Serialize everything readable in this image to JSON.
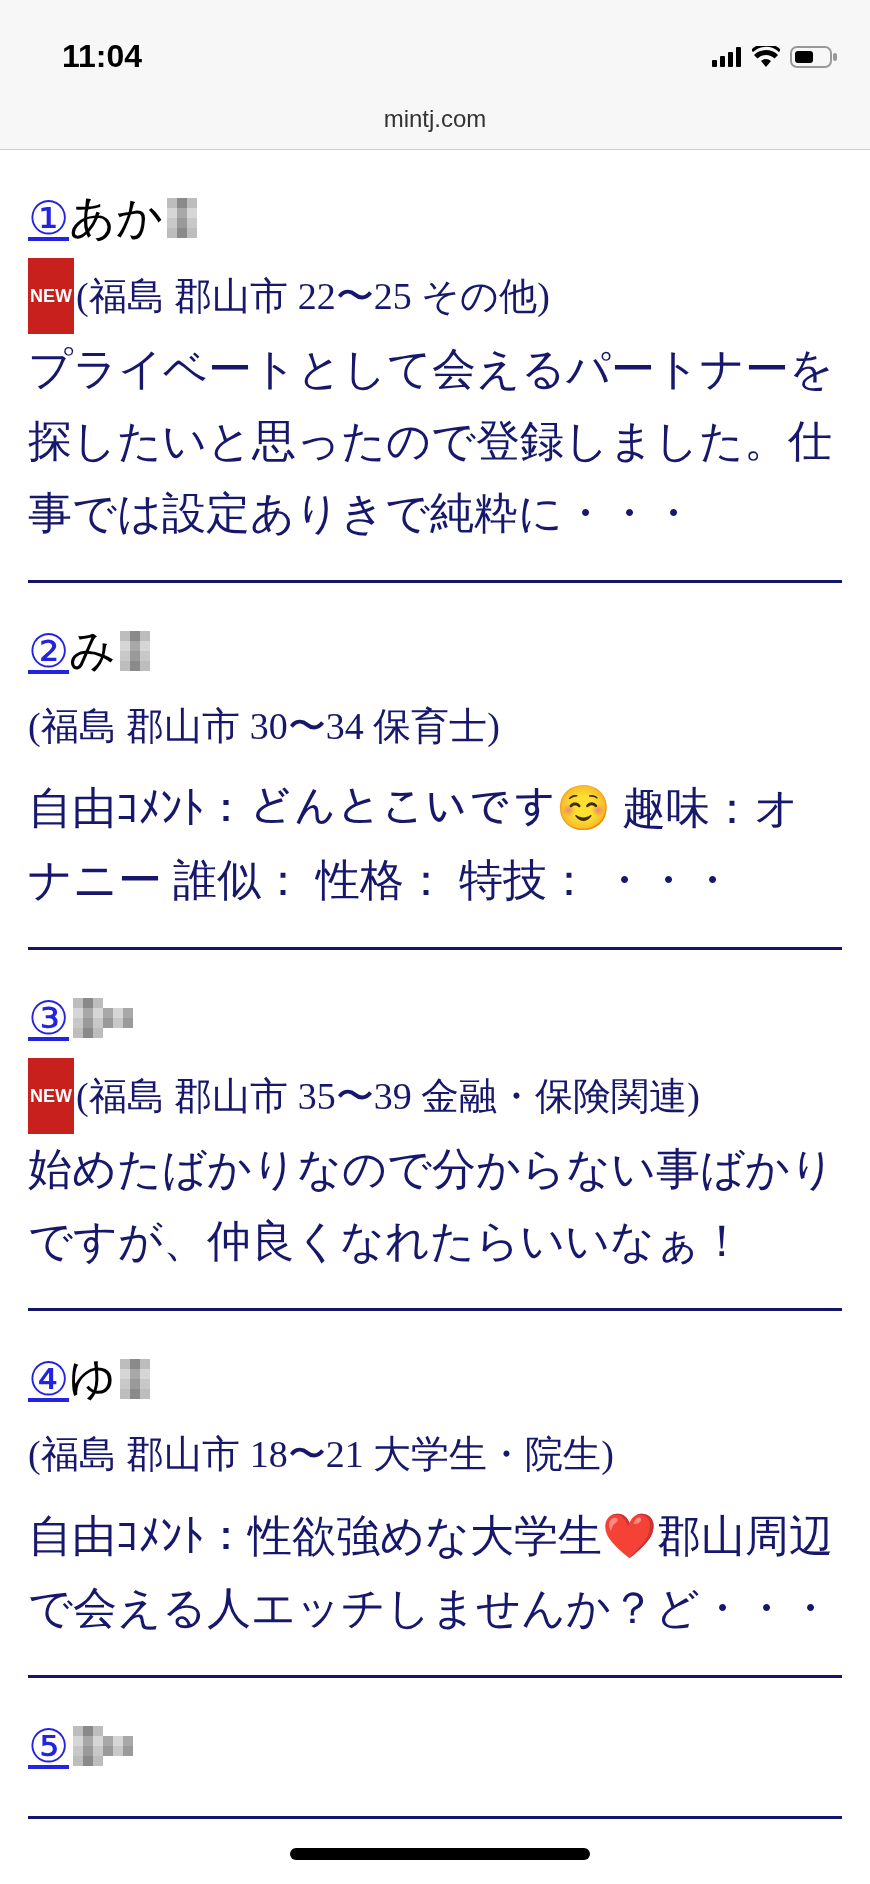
{
  "status_bar": {
    "time": "11:04",
    "url": "mintj.com"
  },
  "profiles": [
    {
      "number": "①",
      "name": "あか",
      "new": true,
      "badge": "NEW",
      "location": "(福島 郡山市 22〜25 その他)",
      "description": "プライベートとして会えるパートナーを探したいと思ったので登録しました。仕事では設定ありきで純粋に・・・"
    },
    {
      "number": "②",
      "name": "み",
      "new": false,
      "location": "(福島 郡山市 30〜34 保育士)",
      "description": "自由ｺﾒﾝﾄ：どんとこいです☺️ 趣味：オナニー 誰似： 性格： 特技： ・・・"
    },
    {
      "number": "③",
      "new": true,
      "badge": "NEW",
      "location": "(福島 郡山市 35〜39 金融・保険関連)",
      "description": "始めたばかりなので分からない事ばかりですが、仲良くなれたらいいなぁ！"
    },
    {
      "number": "④",
      "name": "ゆ",
      "new": false,
      "location": "(福島 郡山市 18〜21 大学生・院生)",
      "description": "自由ｺﾒﾝﾄ：性欲強めな大学生❤️郡山周辺で会える人エッチしませんか？ど・・・"
    },
    {
      "number": "⑤",
      "new": false
    }
  ]
}
